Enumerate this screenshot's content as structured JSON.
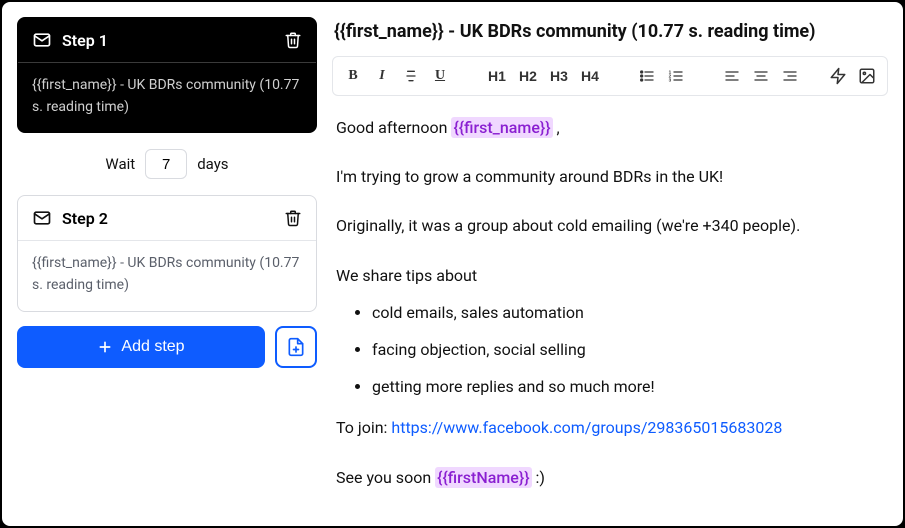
{
  "left": {
    "steps": [
      {
        "title": "Step 1",
        "subject": "{{first_name}} - UK BDRs community (10.77 s. reading time)",
        "active": true
      },
      {
        "title": "Step 2",
        "subject": "{{first_name}} - UK BDRs community (10.77 s. reading time)",
        "active": false
      }
    ],
    "wait_label_before": "Wait",
    "wait_value": "7",
    "wait_label_after": "days",
    "add_step_label": "Add step"
  },
  "editor": {
    "subject": "{{first_name}} - UK BDRs community (10.77 s. reading time)",
    "body": {
      "greeting_before": "Good afternoon ",
      "greeting_var": "{{first_name}}",
      "greeting_after": " ,",
      "p1": "I'm trying to grow a community around BDRs in the UK!",
      "p2": "Originally, it was a group about cold emailing (we're +340 people).",
      "tips_intro": "We share tips about",
      "tips": [
        "cold emails, sales automation",
        "facing objection, social selling",
        "getting more replies and so much more!"
      ],
      "join_before": "To join: ",
      "join_link": "https://www.facebook.com/groups/298365015683028",
      "signoff_before": "See you soon ",
      "signoff_var": "{{firstName}}",
      "signoff_after": " :)"
    }
  },
  "toolbar": {
    "h1": "H1",
    "h2": "H2",
    "h3": "H3",
    "h4": "H4"
  }
}
